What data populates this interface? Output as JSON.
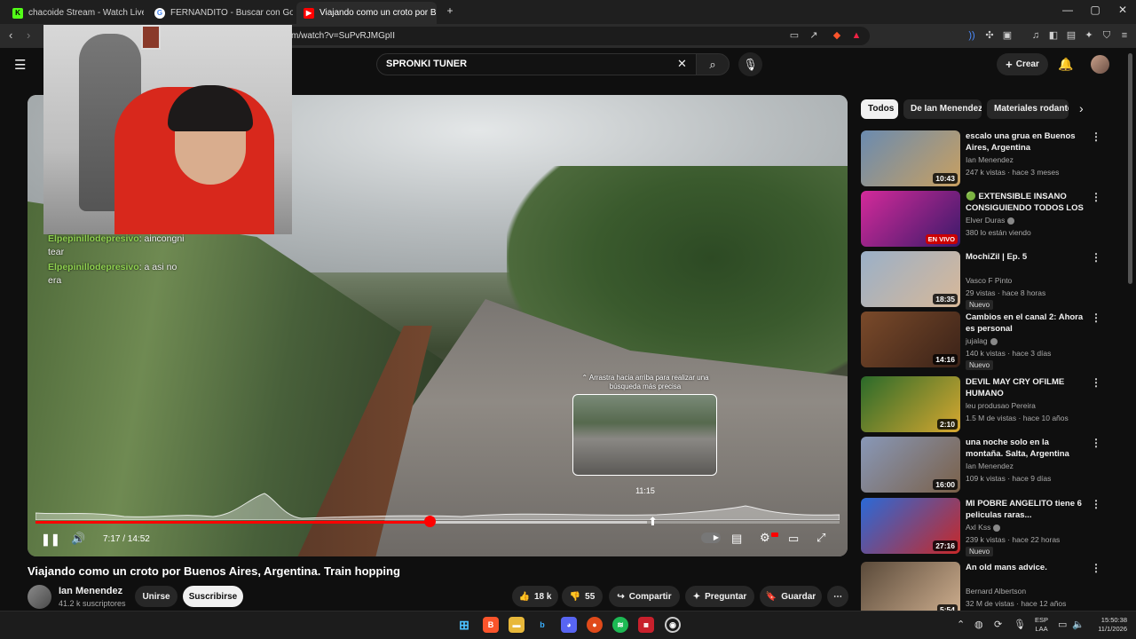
{
  "browser": {
    "tabs": [
      {
        "title": "chacoide Stream - Watch Live on",
        "active": false,
        "favicon": "kick-icon",
        "color": "#53fc18"
      },
      {
        "title": "FERNANDITO - Buscar con Google",
        "active": false,
        "favicon": "google-icon",
        "color": "#4285f4"
      },
      {
        "title": "Viajando como un croto por B",
        "active": true,
        "favicon": "youtube-icon",
        "color": "#ff0000"
      }
    ],
    "url": "m/watch?v=SuPvRJMGpII"
  },
  "header": {
    "search_query": "SPRONKI TUNER",
    "create_label": "Crear"
  },
  "player": {
    "chat": [
      {
        "user": "Elpepinillodepresivo",
        "text": ": aincongni",
        "cont": "tear"
      },
      {
        "user": "Elpepinillodepresivo",
        "text": ": a asi no",
        "cont": "era"
      }
    ],
    "hint": "Arrastra hacia arriba para realizar una búsqueda más precisa",
    "preview_time": "11:15",
    "time_display": "7:17 / 14:52",
    "progress": 0.4899,
    "buffered": 0.76
  },
  "video": {
    "title": "Viajando como un croto por Buenos Aires, Argentina. Train hopping",
    "channel": "Ian Menendez",
    "subscribers": "41.2 k suscriptores",
    "join_label": "Unirse",
    "subscribe_label": "Suscribirse",
    "likes": "18 k",
    "dislikes": "55",
    "share_label": "Compartir",
    "ask_label": "Preguntar",
    "save_label": "Guardar"
  },
  "sidebar": {
    "chips": [
      "Todos",
      "De Ian Menendez",
      "Materiales rodantes"
    ],
    "recommendations": [
      {
        "title": "escalo una grua en Buenos Aires, Argentina",
        "channel": "Ian Menendez",
        "meta": "247 k vistas · hace 3 meses",
        "duration": "10:43",
        "badge": "",
        "verified": false,
        "thumb": [
          "#6a8bb0",
          "#c9a060"
        ]
      },
      {
        "title": "🟢 EXTENSIBLE INSANO CONSIGUIENDO TODOS LOS ...",
        "channel": "Elver Duras",
        "meta": "380 lo están viendo",
        "duration": "EN VIVO",
        "badge": "",
        "verified": true,
        "live": true,
        "thumb": [
          "#d42a9a",
          "#3a1a6a"
        ]
      },
      {
        "title": "MochiZil | Ep. 5",
        "channel": "Vasco F Pinto",
        "meta": "29 vistas · hace 8 horas",
        "duration": "18:35",
        "badge": "Nuevo",
        "verified": false,
        "thumb": [
          "#9ab0c8",
          "#d8b898"
        ]
      },
      {
        "title": "Cambios en el canal 2: Ahora es personal",
        "channel": "jujalag",
        "meta": "140 k vistas · hace 3 días",
        "duration": "14:16",
        "badge": "Nuevo",
        "verified": true,
        "thumb": [
          "#7a4a2a",
          "#3a2218"
        ]
      },
      {
        "title": "DEVIL MAY CRY OFILME HUMANO",
        "channel": "leu produsao Pereira",
        "meta": "1.5 M de vistas · hace 10 años",
        "duration": "2:10",
        "badge": "",
        "verified": false,
        "thumb": [
          "#2a6a2a",
          "#d8a830"
        ]
      },
      {
        "title": "una noche solo en la montaña. Salta, Argentina",
        "channel": "Ian Menendez",
        "meta": "109 k vistas · hace 9 días",
        "duration": "16:00",
        "badge": "",
        "verified": false,
        "thumb": [
          "#8898b8",
          "#7a6048"
        ]
      },
      {
        "title": "MI POBRE ANGELITO tiene 6 peliculas raras...",
        "channel": "Axl Kss",
        "meta": "239 k vistas · hace 22 horas",
        "duration": "27:16",
        "badge": "Nuevo",
        "verified": true,
        "thumb": [
          "#2a6ad8",
          "#c82828"
        ]
      },
      {
        "title": "An old mans advice.",
        "channel": "Bernard Albertson",
        "meta": "32 M de vistas · hace 12 años",
        "duration": "5:54",
        "badge": "",
        "verified": false,
        "thumb": [
          "#5a4a3a",
          "#d0b090"
        ]
      }
    ]
  },
  "taskbar": {
    "lang_1": "ESP",
    "lang_2": "LAA",
    "time": "15:50:38",
    "date": "11/1/2026"
  },
  "colors": {
    "accent": "#ff0000",
    "background": "#0f0f0f"
  }
}
